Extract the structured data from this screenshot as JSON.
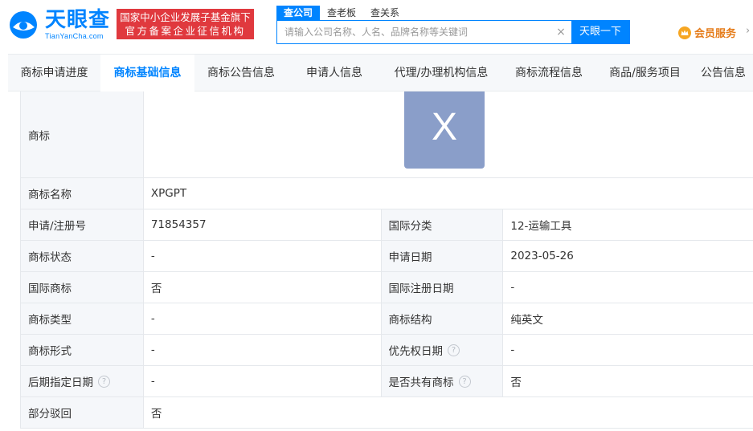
{
  "header": {
    "logo_text": "天眼查",
    "logo_sub": "TianYanCha.com",
    "slogan_line1": "国家中小企业发展子基金旗下",
    "slogan_line2": "官方备案企业征信机构",
    "search_tabs": [
      "查公司",
      "查老板",
      "查关系"
    ],
    "search_placeholder": "请输入公司名称、人名、品牌名称等关键词",
    "clear_symbol": "×",
    "search_button": "天眼一下",
    "vip_label": "会员服务",
    "vip_arrow": "›"
  },
  "nav": {
    "items": [
      "商标申请进度",
      "商标基础信息",
      "商标公告信息",
      "申请人信息",
      "代理/办理机构信息",
      "商标流程信息",
      "商品/服务项目",
      "公告信息"
    ],
    "active_index": 1
  },
  "trademark": {
    "image_label": "商标",
    "image_text": "X",
    "name_label": "商标名称",
    "name_value": "XPGPT",
    "rows": [
      {
        "l1": "申请/注册号",
        "v1": "71854357",
        "l2": "国际分类",
        "v2": "12-运输工具"
      },
      {
        "l1": "商标状态",
        "v1": "-",
        "l2": "申请日期",
        "v2": "2023-05-26"
      },
      {
        "l1": "国际商标",
        "v1": "否",
        "l2": "国际注册日期",
        "v2": "-"
      },
      {
        "l1": "商标类型",
        "v1": "-",
        "l2": "商标结构",
        "v2": "纯英文"
      },
      {
        "l1": "商标形式",
        "v1": "-",
        "l2": "优先权日期",
        "v2": "-"
      },
      {
        "l1": "后期指定日期",
        "v1": "-",
        "l2": "是否共有商标",
        "v2": "否"
      }
    ],
    "help_symbol": "?",
    "partial_label": "部分驳回",
    "partial_value": "否"
  },
  "colors": {
    "brand": "#0084ff",
    "slogan_bg": "#e0393e",
    "vip": "#e57b18",
    "trademark_img": "#8a9ec9"
  }
}
